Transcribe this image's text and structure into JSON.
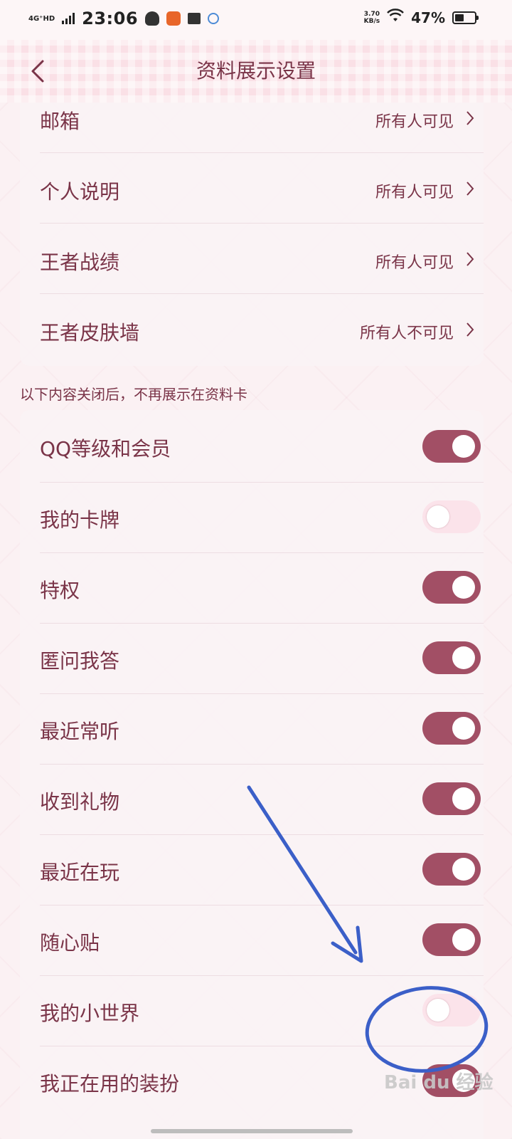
{
  "status_bar": {
    "network_type": "4G⁺HD",
    "time": "23:06",
    "net_speed_value": "3.70",
    "net_speed_unit": "KB/s",
    "battery_percent": "47%"
  },
  "nav": {
    "title": "资料展示设置"
  },
  "visibility_rows": [
    {
      "label": "邮箱",
      "value": "所有人可见"
    },
    {
      "label": "个人说明",
      "value": "所有人可见"
    },
    {
      "label": "王者战绩",
      "value": "所有人可见"
    },
    {
      "label": "王者皮肤墙",
      "value": "所有人不可见"
    }
  ],
  "section_label": "以下内容关闭后，不再展示在资料卡",
  "toggle_rows": [
    {
      "label": "QQ等级和会员",
      "enabled": true
    },
    {
      "label": "我的卡牌",
      "enabled": false
    },
    {
      "label": "特权",
      "enabled": true
    },
    {
      "label": "匿问我答",
      "enabled": true
    },
    {
      "label": "最近常听",
      "enabled": true
    },
    {
      "label": "收到礼物",
      "enabled": true
    },
    {
      "label": "最近在玩",
      "enabled": true
    },
    {
      "label": "随心贴",
      "enabled": true
    },
    {
      "label": "我的小世界",
      "enabled": false
    },
    {
      "label": "我正在用的装扮",
      "enabled": true
    }
  ],
  "colors": {
    "accent": "#a24f65",
    "text": "#7a3448",
    "toggle_off": "#fbe3ea",
    "annotation": "#3b5fc8"
  },
  "watermark": "Bai du 经验"
}
